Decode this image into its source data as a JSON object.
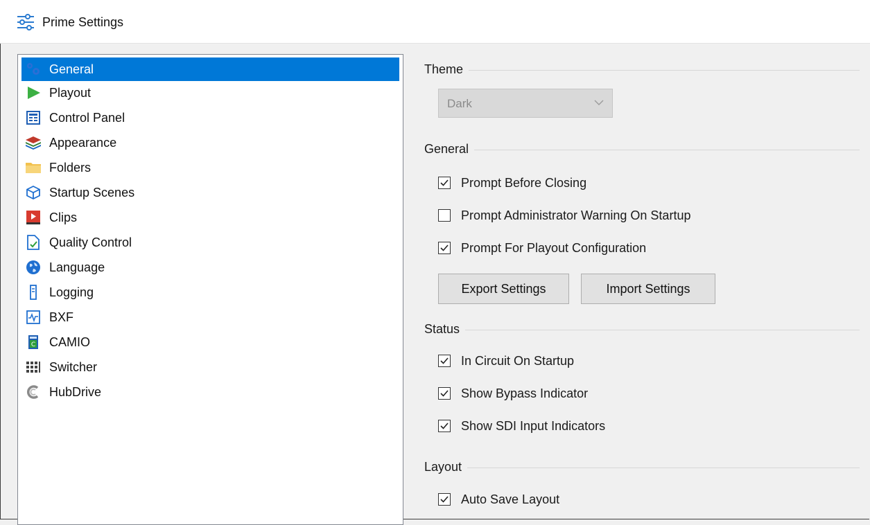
{
  "window": {
    "title": "Prime Settings"
  },
  "nav": {
    "items": [
      {
        "label": "General",
        "icon": "gear-icon",
        "selected": true
      },
      {
        "label": "Playout",
        "icon": "play-icon"
      },
      {
        "label": "Control Panel",
        "icon": "control-panel-icon"
      },
      {
        "label": "Appearance",
        "icon": "layers-icon"
      },
      {
        "label": "Folders",
        "icon": "folder-icon"
      },
      {
        "label": "Startup Scenes",
        "icon": "cube-icon"
      },
      {
        "label": "Clips",
        "icon": "clips-icon"
      },
      {
        "label": "Quality Control",
        "icon": "document-check-icon"
      },
      {
        "label": "Language",
        "icon": "globe-icon"
      },
      {
        "label": "Logging",
        "icon": "logging-icon"
      },
      {
        "label": "BXF",
        "icon": "bxf-icon"
      },
      {
        "label": "CAMIO",
        "icon": "camio-icon"
      },
      {
        "label": "Switcher",
        "icon": "grid-icon"
      },
      {
        "label": "HubDrive",
        "icon": "hubdrive-icon"
      }
    ]
  },
  "theme": {
    "heading": "Theme",
    "selected": "Dark"
  },
  "general": {
    "heading": "General",
    "prompt_before_closing": {
      "label": "Prompt Before Closing",
      "checked": true
    },
    "prompt_admin_warning": {
      "label": "Prompt Administrator Warning On Startup",
      "checked": false
    },
    "prompt_playout_config": {
      "label": "Prompt For Playout Configuration",
      "checked": true
    },
    "export_label": "Export Settings",
    "import_label": "Import Settings"
  },
  "status": {
    "heading": "Status",
    "in_circuit": {
      "label": "In Circuit On Startup",
      "checked": true
    },
    "bypass_indicator": {
      "label": "Show Bypass Indicator",
      "checked": true
    },
    "sdi_indicators": {
      "label": "Show SDI Input Indicators",
      "checked": true
    }
  },
  "layout": {
    "heading": "Layout",
    "auto_save": {
      "label": "Auto Save Layout",
      "checked": true
    }
  },
  "colors": {
    "selection": "#0078d7",
    "play_green": "#3cb043",
    "folder_yellow": "#f2c14e",
    "clips_red": "#d83b2f"
  }
}
